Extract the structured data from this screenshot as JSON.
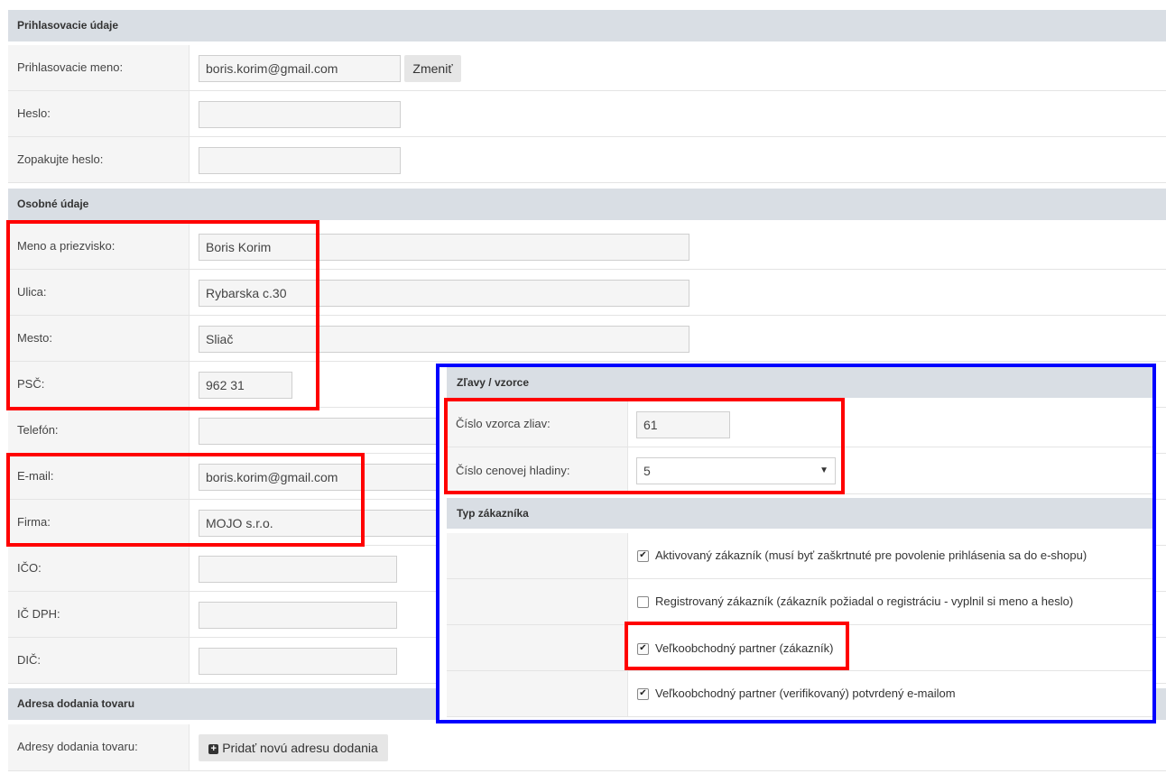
{
  "login": {
    "header": "Prihlasovacie údaje",
    "username_label": "Prihlasovacie meno:",
    "username_value": "boris.korim@gmail.com",
    "change_button": "Zmeniť",
    "password_label": "Heslo:",
    "password_value": "",
    "password_repeat_label": "Zopakujte heslo:",
    "password_repeat_value": ""
  },
  "personal": {
    "header": "Osobné údaje",
    "name_label": "Meno a priezvisko:",
    "name_value": "Boris Korim",
    "street_label": "Ulica:",
    "street_value": "Rybarska c.30",
    "city_label": "Mesto:",
    "city_value": "Sliač",
    "zip_label": "PSČ:",
    "zip_value": "962 31",
    "phone_label": "Telefón:",
    "phone_value": "",
    "email_label": "E-mail:",
    "email_value": "boris.korim@gmail.com",
    "company_label": "Firma:",
    "company_value": "MOJO s.r.o.",
    "ico_label": "IČO:",
    "ico_value": "",
    "icdph_label": "IČ DPH:",
    "icdph_value": "",
    "dic_label": "DIČ:",
    "dic_value": ""
  },
  "delivery": {
    "header": "Adresa dodania tovaru",
    "addresses_label": "Adresy dodania tovaru:",
    "add_button": "Pridať novú adresu dodania"
  },
  "discounts": {
    "header": "Zľavy / vzorce",
    "pattern_label": "Číslo vzorca zliav:",
    "pattern_value": "61",
    "price_level_label": "Číslo cenovej hladiny:",
    "price_level_value": "5"
  },
  "customer_type": {
    "header": "Typ zákazníka",
    "options": [
      {
        "label": "Aktivovaný zákazník (musí byť zaškrtnuté pre povolenie prihlásenia sa do e-shopu)",
        "checked": true
      },
      {
        "label": "Registrovaný zákazník (zákazník požiadal o registráciu - vyplnil si meno a heslo)",
        "checked": false
      },
      {
        "label": "Veľkoobchodný partner (zákazník)",
        "checked": true
      },
      {
        "label": "Veľkoobchodný partner (verifikovaný) potvrdený e-mailom",
        "checked": true
      }
    ]
  },
  "icons": {
    "check": "checkmark-icon",
    "plus": "plus-square-icon",
    "caret": "caret-down-icon"
  },
  "colors": {
    "header_bg": "#d9dee4",
    "label_bg": "#f5f5f5",
    "highlight_red": "#ff0000",
    "highlight_blue": "#0000ff"
  }
}
